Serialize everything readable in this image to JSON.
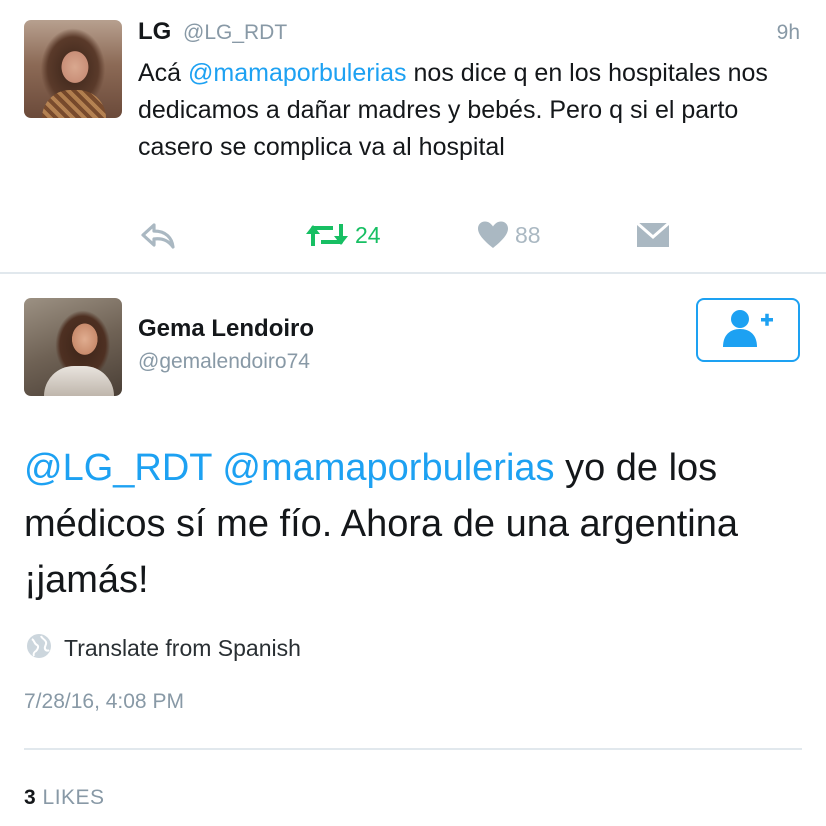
{
  "parent_tweet": {
    "author_name": "LG",
    "author_handle": "@LG_RDT",
    "time_ago": "9h",
    "text_prefix": "Acá ",
    "mention": "@mamaporbulerias",
    "text_body": " nos dice q en los hospitales nos dedicamos a dañar madres y bebés. Pero q si el parto casero se complica va al hospital",
    "retweet_count": "24",
    "like_count": "88",
    "icons": {
      "reply": "reply-icon",
      "retweet": "retweet-icon",
      "like": "heart-icon",
      "dm": "envelope-icon"
    }
  },
  "main_tweet": {
    "author_name": "Gema Lendoiro",
    "author_handle": "@gemalendoiro74",
    "mention_1": "@LG_RDT",
    "mention_2": "@mamaporbulerias",
    "text_body": " yo de los médicos sí me fío. Ahora de una argentina ¡jamás!",
    "translate_label": "Translate from Spanish",
    "timestamp": "7/28/16, 4:08 PM",
    "likes_count": "3",
    "likes_label": "LIKES"
  },
  "colors": {
    "accent": "#1da1f2",
    "retweet": "#17bf63",
    "muted": "#8899a6",
    "icon_gray": "#aab8c2"
  }
}
